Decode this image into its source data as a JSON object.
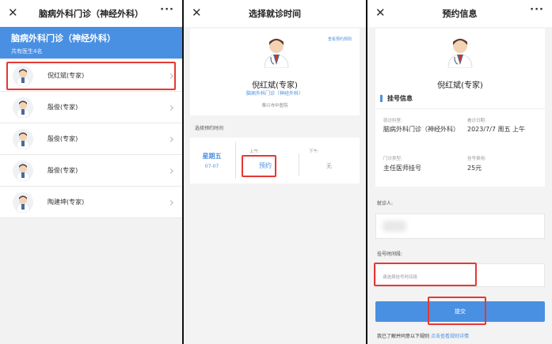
{
  "screen1": {
    "nav": {
      "close": "✕",
      "title": "脑病外科门诊（神经外科）",
      "more": "···"
    },
    "dept": {
      "name": "脑病外科门诊（神经外科）",
      "count": "共有医生4名"
    },
    "doctors": [
      {
        "name": "倪红斌(专家)"
      },
      {
        "name": "殷俊(专家)"
      },
      {
        "name": "殷俊(专家)"
      },
      {
        "name": "殷俊(专家)"
      },
      {
        "name": "陶建坤(专家)"
      }
    ]
  },
  "screen2": {
    "nav": {
      "close": "✕",
      "title": "选择就诊时间"
    },
    "doctor": {
      "rule_link": "查看预约规则",
      "name": "倪红斌(专家)",
      "dept": "脑病外科门诊（神经外科）",
      "hospital": "泰兴市中医院"
    },
    "section_label": "选择预约时间",
    "slot": {
      "weekday": "星期五",
      "date": "07-07",
      "am_label": "上午:",
      "am_action": "预约",
      "pm_label": "下午:",
      "pm_value": "无"
    }
  },
  "screen3": {
    "nav": {
      "close": "✕",
      "title": "预约信息",
      "more": "···"
    },
    "doctor_name": "倪红斌(专家)",
    "section_title": "挂号信息",
    "fields": {
      "dept_label": "就诊科室:",
      "dept_value": "脑病外科门诊（神经外科）",
      "date_label": "看诊日期:",
      "date_value": "2023/7/7 周五 上午",
      "type_label": "门诊类型:",
      "type_value": "主任医师挂号",
      "fee_label": "挂号费用:",
      "fee_value": "25元"
    },
    "patient_label": "就诊人:",
    "timeslot_label": "挂号时间段:",
    "timeslot_placeholder": "请选择挂号时间段",
    "submit": "提交",
    "note_prefix": "我已了解并同意以下规则",
    "note_link": "点击查看规则详情"
  },
  "colors": {
    "accent": "#4a90e2",
    "highlight": "#e53935"
  }
}
